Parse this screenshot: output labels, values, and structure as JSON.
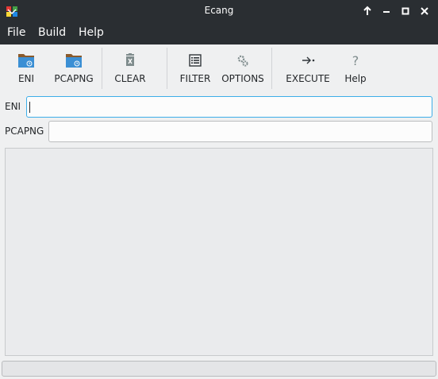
{
  "window": {
    "title": "Ecang"
  },
  "icons": {
    "app": "app-logo-icon",
    "keep_above": "arrow-up-icon",
    "minimize": "minimize-icon",
    "maximize": "maximize-icon",
    "close": "close-icon"
  },
  "menubar": {
    "items": [
      "File",
      "Build",
      "Help"
    ]
  },
  "toolbar": {
    "eni_label": "ENI",
    "pcapng_label": "PCAPNG",
    "clear_label": "CLEAR",
    "filter_label": "FILTER",
    "options_label": "OPTIONS",
    "execute_label": "EXECUTE",
    "help_label": "Help"
  },
  "form": {
    "eni_label": "ENI",
    "eni_value": "",
    "pcapng_label": "PCAPNG",
    "pcapng_value": ""
  },
  "colors": {
    "titlebar": "#2a2e32",
    "window_bg": "#eff0f1",
    "focus": "#3daee9",
    "folder_tab": "#8a5a2b",
    "folder_body": "#3b8fd4"
  }
}
